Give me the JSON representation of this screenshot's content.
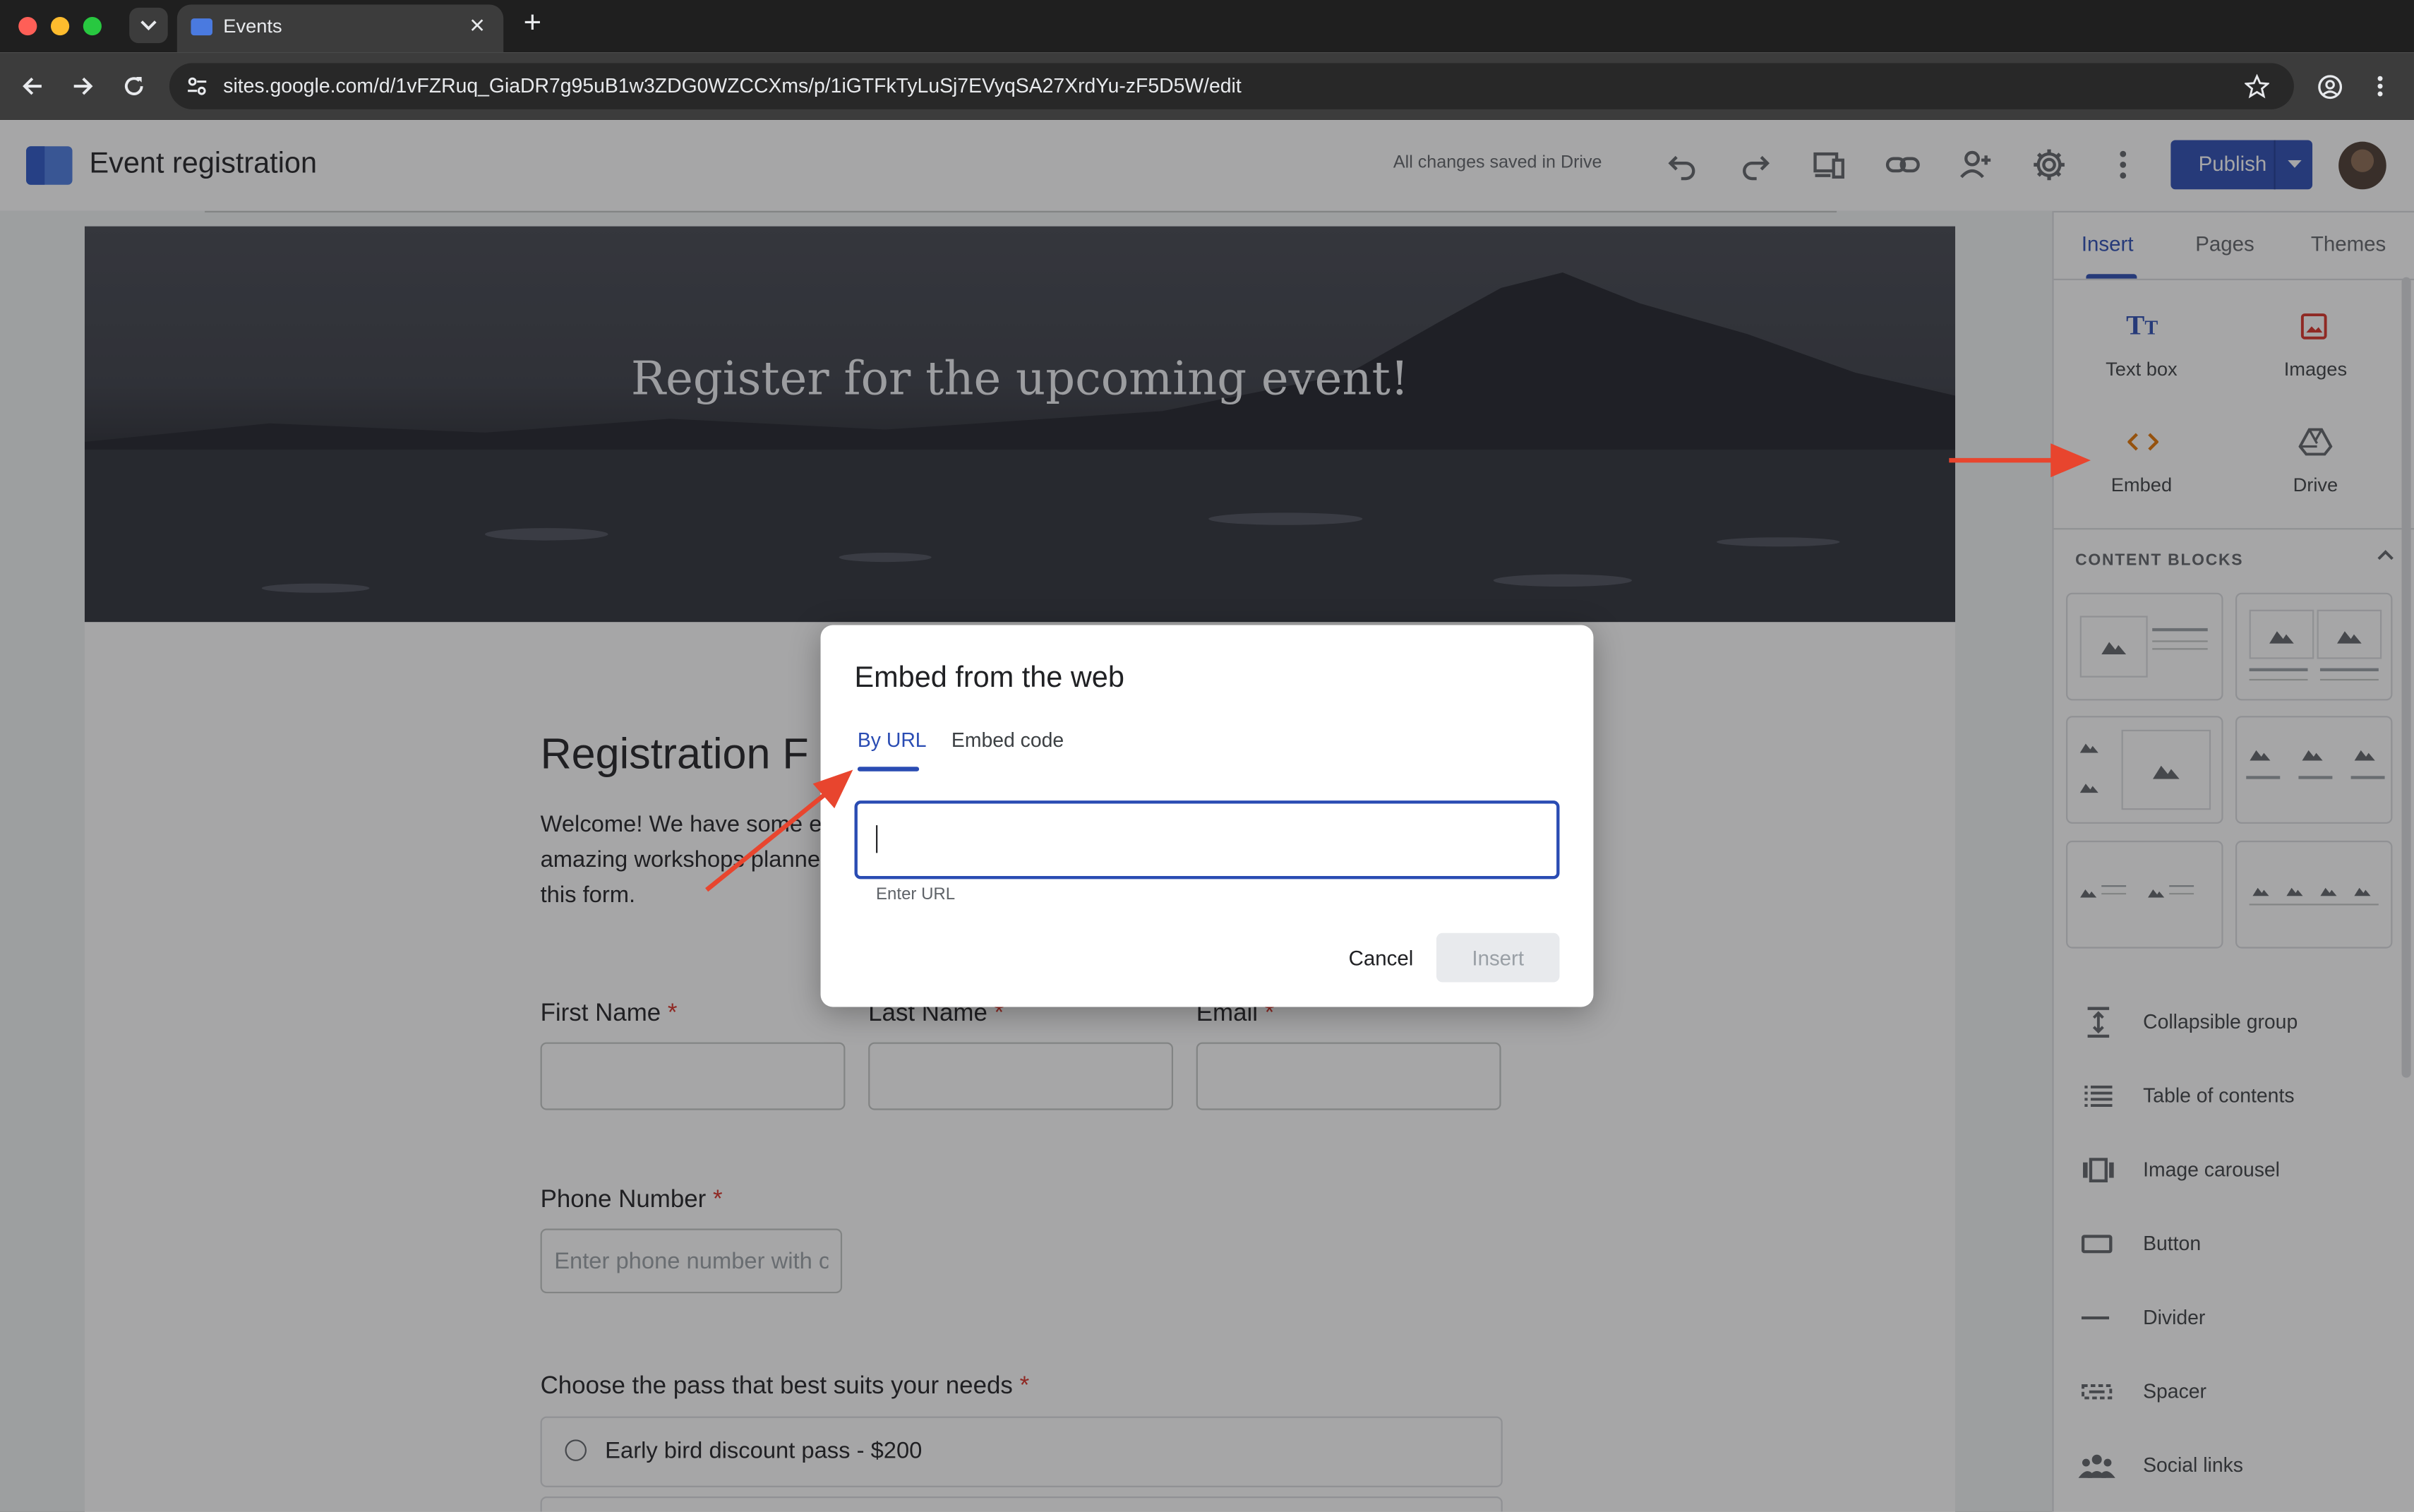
{
  "browser": {
    "tab_title": "Events",
    "url": "sites.google.com/d/1vFZRuq_GiaDR7g95uB1w3ZDG0WZCCXms/p/1iGTFkTyLuSj7EVyqSA27XrdYu-zF5D5W/edit",
    "new_tab_symbol": "+",
    "close_symbol": "×"
  },
  "app": {
    "site_title": "Event registration",
    "save_status": "All changes saved in Drive",
    "publish_label": "Publish"
  },
  "page": {
    "hero_title": "Register for the upcoming event!",
    "form_heading": "Registration F",
    "welcome_lines": [
      "Welcome! We have some e",
      "amazing workshops planne",
      "this form."
    ],
    "first_name_label": "First Name",
    "last_name_label": "Last Name",
    "email_label": "Email",
    "required_mark": "*",
    "phone_label": "Phone Number",
    "phone_placeholder": "Enter phone number with cc",
    "pass_question": "Choose the pass that best suits your needs",
    "pass_option_1": "Early bird discount pass - $200"
  },
  "sidebar": {
    "tabs": [
      "Insert",
      "Pages",
      "Themes"
    ],
    "active_tab": "Insert",
    "insert_items": [
      {
        "label": "Text box",
        "icon": "text-box-icon",
        "color": "#2a4cb3"
      },
      {
        "label": "Images",
        "icon": "image-icon",
        "color": "#d93025"
      },
      {
        "label": "Embed",
        "icon": "embed-code-icon",
        "color": "#e37400"
      },
      {
        "label": "Drive",
        "icon": "drive-icon",
        "color": "#5f6368"
      }
    ],
    "content_blocks_title": "CONTENT BLOCKS",
    "components": [
      {
        "label": "Collapsible group",
        "icon": "collapsible-group-icon"
      },
      {
        "label": "Table of contents",
        "icon": "table-of-contents-icon"
      },
      {
        "label": "Image carousel",
        "icon": "image-carousel-icon"
      },
      {
        "label": "Button",
        "icon": "button-icon"
      },
      {
        "label": "Divider",
        "icon": "divider-icon"
      },
      {
        "label": "Spacer",
        "icon": "spacer-icon"
      },
      {
        "label": "Social links",
        "icon": "social-links-icon"
      }
    ]
  },
  "dialog": {
    "title": "Embed from the web",
    "tabs": [
      "By URL",
      "Embed code"
    ],
    "active_tab": "By URL",
    "url_value": "",
    "helper_text": "Enter URL",
    "cancel_label": "Cancel",
    "insert_label": "Insert"
  },
  "colors": {
    "accent": "#2a4cb3",
    "annotation_arrow": "#e8452e"
  }
}
